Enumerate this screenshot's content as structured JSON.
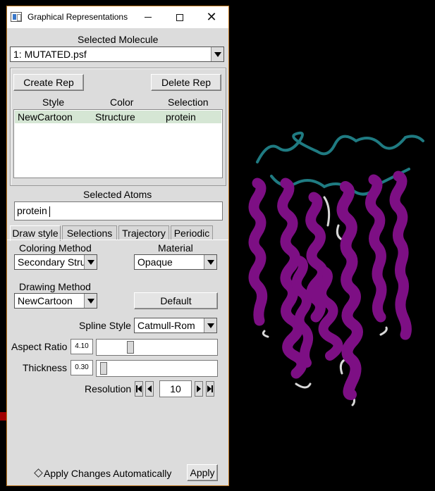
{
  "window": {
    "title": "Graphical Representations",
    "close_glyph": "✕"
  },
  "molecule": {
    "label": "Selected Molecule",
    "value": "1: MUTATED.psf"
  },
  "reps": {
    "create_label": "Create Rep",
    "delete_label": "Delete Rep",
    "columns": [
      "Style",
      "Color",
      "Selection"
    ],
    "rows": [
      {
        "style": "NewCartoon",
        "color": "Structure",
        "selection": "protein"
      }
    ]
  },
  "atoms": {
    "label": "Selected Atoms",
    "value": "protein"
  },
  "tabs": [
    {
      "label": "Draw style",
      "active": true
    },
    {
      "label": "Selections",
      "active": false
    },
    {
      "label": "Trajectory",
      "active": false
    },
    {
      "label": "Periodic",
      "active": false
    }
  ],
  "draw": {
    "coloring_label": "Coloring Method",
    "coloring_value": "Secondary Stru",
    "material_label": "Material",
    "material_value": "Opaque",
    "drawing_label": "Drawing Method",
    "drawing_value": "NewCartoon",
    "default_label": "Default",
    "spline_label": "Spline Style",
    "spline_value": "Catmull-Rom",
    "aspect_label": "Aspect Ratio",
    "aspect_value": "4.10",
    "aspect_fraction": 0.26,
    "thickness_label": "Thickness",
    "thickness_value": "0.30",
    "thickness_fraction": 0.02,
    "resolution_label": "Resolution",
    "resolution_value": "10"
  },
  "footer": {
    "auto_label": "Apply Changes Automatically",
    "apply_label": "Apply"
  },
  "colors": {
    "helix": "#7d0f84",
    "coil": "#1f7b82",
    "turn": "#d8d8d8",
    "window_border": "#c0781e"
  }
}
